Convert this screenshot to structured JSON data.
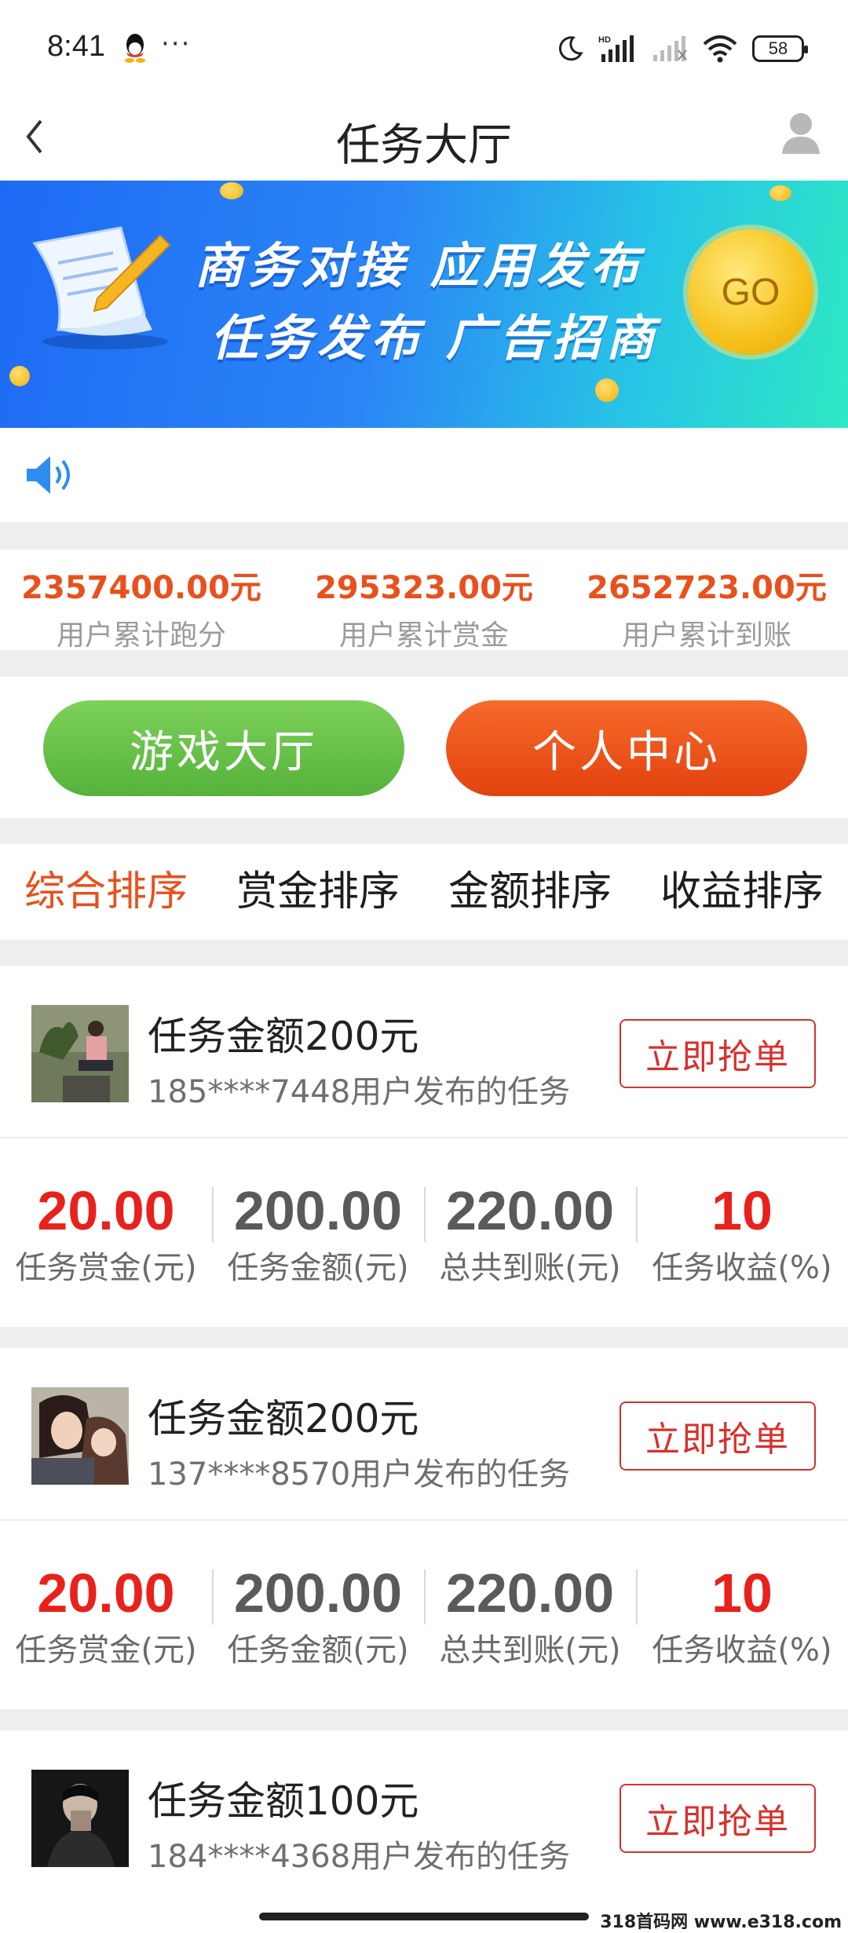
{
  "status_bar": {
    "time": "8:41",
    "dots": "···",
    "network": "HD",
    "battery": "58"
  },
  "nav": {
    "title": "任务大厅"
  },
  "banner": {
    "line1": "商务对接 应用发布",
    "line2": "任务发布 广告招商",
    "go_label": "GO"
  },
  "stats": [
    {
      "value": "2357400.00元",
      "label": "用户累计跑分"
    },
    {
      "value": "295323.00元",
      "label": "用户累计赏金"
    },
    {
      "value": "2652723.00元",
      "label": "用户累计到账"
    }
  ],
  "buttons": {
    "game_hall": "游戏大厅",
    "personal_center": "个人中心"
  },
  "tabs": [
    "综合排序",
    "赏金排序",
    "金额排序",
    "收益排序"
  ],
  "grab_label": "立即抢单",
  "tasks": [
    {
      "title": "任务金额200元",
      "subtitle": "185****7448用户发布的任务",
      "values": [
        "20.00",
        "200.00",
        "220.00",
        "10"
      ],
      "labels": [
        "任务赏金(元)",
        "任务金额(元)",
        "总共到账(元)",
        "任务收益(%)"
      ]
    },
    {
      "title": "任务金额200元",
      "subtitle": "137****8570用户发布的任务",
      "values": [
        "20.00",
        "200.00",
        "220.00",
        "10"
      ],
      "labels": [
        "任务赏金(元)",
        "任务金额(元)",
        "总共到账(元)",
        "任务收益(%)"
      ]
    },
    {
      "title": "任务金额100元",
      "subtitle": "184****4368用户发布的任务"
    }
  ],
  "watermark": "318首码网 www.e318.com",
  "colors": {
    "accent": "#e8511c",
    "red": "#e8211c",
    "green": "#55b23a",
    "banner_blue": "#1e6af5"
  }
}
